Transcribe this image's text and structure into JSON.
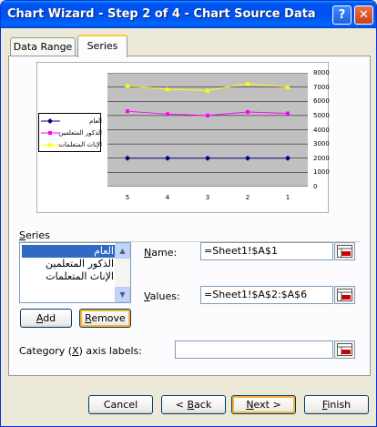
{
  "window": {
    "title": "Chart Wizard - Step 2 of 4 - Chart Source Data",
    "help_glyph": "?",
    "close_glyph": "✕"
  },
  "tabs": [
    {
      "label": "Data Range"
    },
    {
      "label": "Series"
    }
  ],
  "chart_data": {
    "type": "line",
    "categories": [
      "5",
      "4",
      "3",
      "2",
      "1"
    ],
    "series": [
      {
        "name": "العام",
        "values": [
          2000,
          2000,
          2000,
          2000,
          2000
        ],
        "color": "#00007f"
      },
      {
        "name": "الذكور المتعلمين",
        "values": [
          5300,
          5100,
          5000,
          5250,
          5150
        ],
        "color": "#ff00ff"
      },
      {
        "name": "الإناث المتعلمات",
        "values": [
          7100,
          6850,
          6750,
          7250,
          7000
        ],
        "color": "#ffff00"
      }
    ],
    "ylim": [
      0,
      8000
    ],
    "yticks": [
      "0",
      "1000",
      "2000",
      "3000",
      "4000",
      "5000",
      "6000",
      "7000",
      "8000"
    ],
    "plot_bg": "#c0c0c0",
    "grid": true,
    "legend_position": "left",
    "y_axis_side": "right"
  },
  "series_section": {
    "label": "Series",
    "items": [
      "العام",
      "الذكور المتعلمين",
      "الإناث المتعلمات"
    ],
    "selected_index": 0,
    "add_label": "Add",
    "remove_label": "Remove"
  },
  "name_field": {
    "label": "Name:",
    "value": "=Sheet1!$A$1"
  },
  "values_field": {
    "label": "Values:",
    "value": "=Sheet1!$A$2:$A$6"
  },
  "category_field": {
    "label": "Category (X) axis labels:",
    "value": ""
  },
  "footer": {
    "cancel": "Cancel",
    "back": "< Back",
    "next": "Next >",
    "finish": "Finish"
  }
}
